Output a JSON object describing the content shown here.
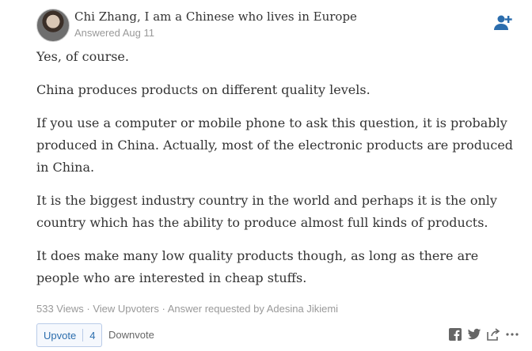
{
  "author": {
    "name": "Chi Zhang",
    "credential": ", I am a Chinese who lives in Europe",
    "answered": "Answered Aug 11"
  },
  "answer": {
    "paragraphs": [
      "Yes, of course.",
      "China produces products on different quality levels.",
      "If you use a computer or mobile phone to ask this question, it is probably produced in China. Actually, most of the electronic products are produced in China.",
      "It is the biggest industry country in the world and perhaps it is the only country which has the ability to produce almost full kinds of products.",
      "It does make many low quality products though, as long as there are people who are interested in cheap stuffs."
    ]
  },
  "stats": {
    "views": "533 Views",
    "sep1": " · ",
    "upvoters_link": "View Upvoters",
    "sep2": " · ",
    "requested": "Answer requested by Adesina Jikiemi"
  },
  "actions": {
    "upvote_label": "Upvote",
    "upvote_count": "4",
    "downvote_label": "Downvote"
  },
  "icons": {
    "follow": "follow-user-icon",
    "facebook": "facebook-icon",
    "twitter": "twitter-icon",
    "share": "share-icon",
    "more": "more-icon"
  },
  "colors": {
    "accent": "#2b6dad",
    "muted": "#999999",
    "text": "#333333"
  }
}
